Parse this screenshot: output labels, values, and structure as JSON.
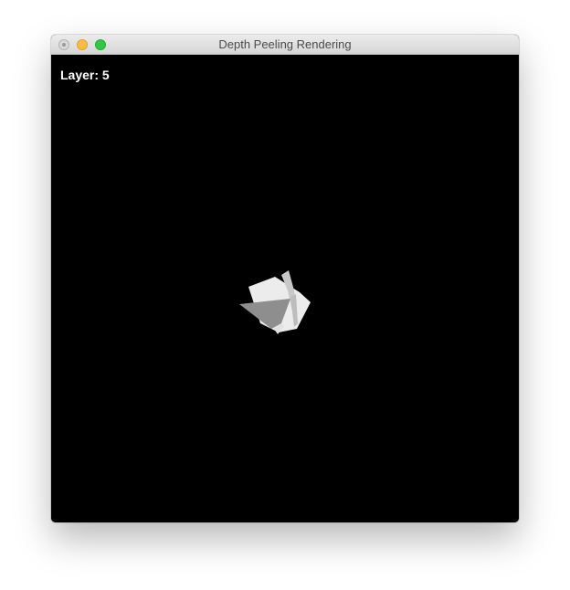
{
  "window": {
    "title": "Depth Peeling Rendering"
  },
  "overlay": {
    "layer_text": "Layer: 5"
  },
  "colors": {
    "background": "#000000",
    "polygon_light": "#ececec",
    "polygon_mid": "#d4d4d4",
    "polygon_dark": "#8e8e8e",
    "overlay_text": "#ffffff"
  }
}
